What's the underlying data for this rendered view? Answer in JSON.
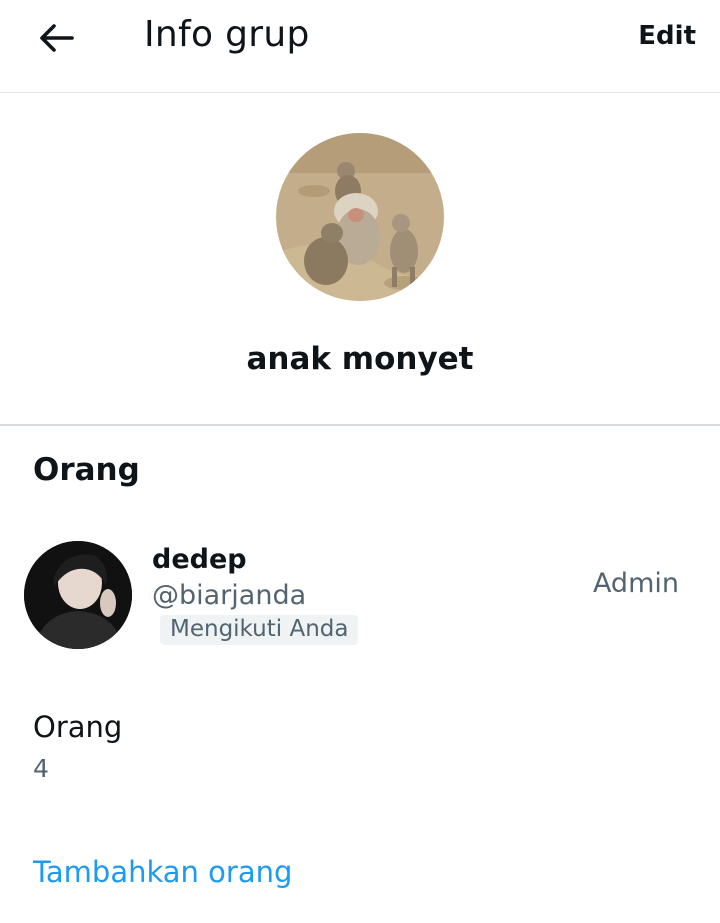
{
  "header": {
    "title": "Info grup",
    "edit_label": "Edit"
  },
  "group": {
    "name": "anak monyet"
  },
  "people_section": {
    "heading": "Orang",
    "members": [
      {
        "name": "dedep",
        "handle": "@biarjanda",
        "badge": "Mengikuti Anda",
        "role": "Admin"
      }
    ]
  },
  "stats": {
    "people_label": "Orang",
    "people_count": "4"
  },
  "actions": {
    "add_people_label": "Tambahkan orang"
  },
  "colors": {
    "primary_text": "#0f1419",
    "secondary_text": "#536471",
    "link": "#1d9bf0",
    "badge_bg": "#eff3f4",
    "divider": "#d7dbdf"
  },
  "icons": {
    "back": "arrow-left-icon"
  }
}
